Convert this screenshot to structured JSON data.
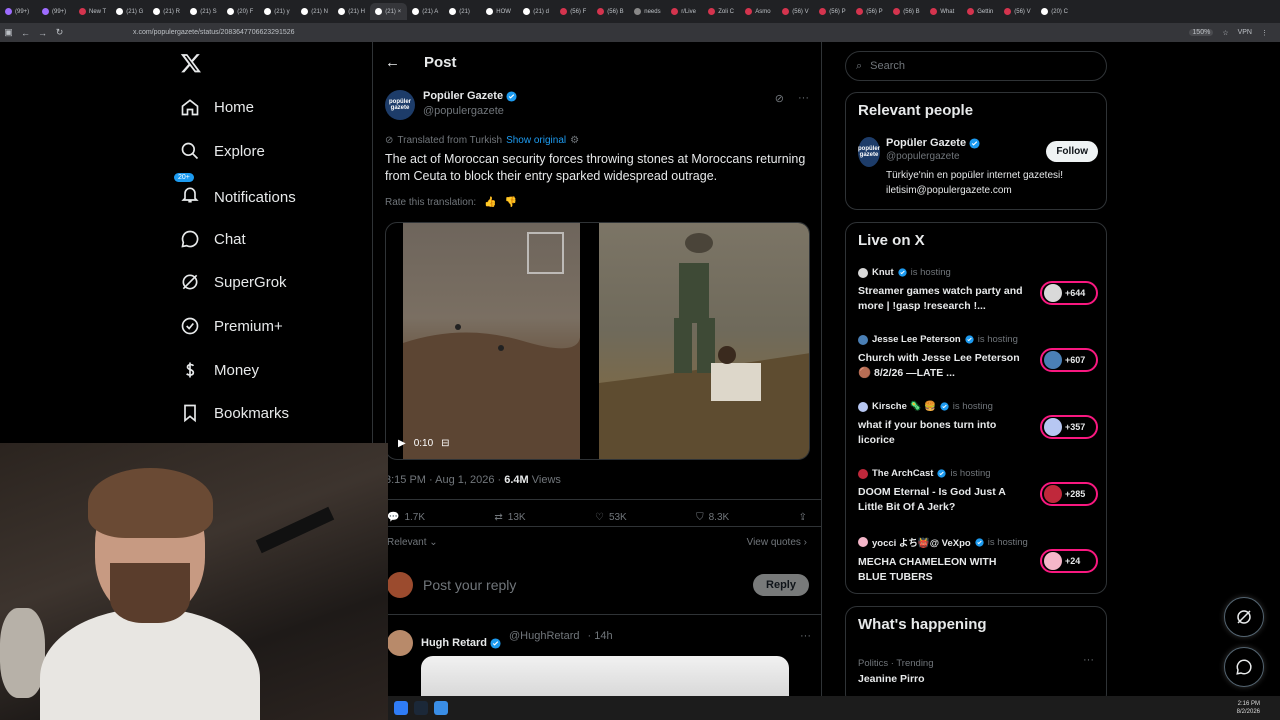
{
  "browser": {
    "tabs": [
      "(99+)",
      "(99+)",
      "New T",
      "(21) G",
      "(21) R",
      "(21) S",
      "(20) F",
      "(21) y",
      "(21) N",
      "(21) H",
      "(21) ×",
      "(21) A",
      "(21)",
      "HOW",
      "(21) d",
      "(56) F",
      "(56) B",
      "needs",
      "r/Live",
      "Zoli C",
      "Asmo",
      "(56) V",
      "(56) P",
      "(56) P",
      "(56) B",
      "What",
      "Gettin",
      "(56) V",
      "(20) C"
    ],
    "url": "x.com/populergazete/status/2083647706623291526",
    "zoom": "150%",
    "vpn": "VPN"
  },
  "nav": {
    "items": [
      {
        "label": "Home",
        "icon": "home-icon"
      },
      {
        "label": "Explore",
        "icon": "search-icon"
      },
      {
        "label": "Notifications",
        "icon": "bell-icon",
        "badge": "20+"
      },
      {
        "label": "Chat",
        "icon": "chat-icon"
      },
      {
        "label": "SuperGrok",
        "icon": "grok-icon"
      },
      {
        "label": "Premium+",
        "icon": "premium-icon"
      },
      {
        "label": "Money",
        "icon": "dollar-icon"
      },
      {
        "label": "Bookmarks",
        "icon": "bookmark-icon"
      }
    ]
  },
  "post": {
    "header": "Post",
    "author_name": "Popüler Gazete",
    "author_handle": "@populergazete",
    "avatar_text": "popüler gazete",
    "translated_from": "Translated from Turkish",
    "show_original": "Show original",
    "text": "The act of Moroccan security forces throwing stones at Moroccans returning from Ceuta to block their entry sparked widespread outrage.",
    "rate_translation": "Rate this translation:",
    "video_time": "0:10",
    "timestamp": "3:15 PM · Aug 1, 2026 · ",
    "views_count": "6.4M",
    "views_label": "Views",
    "replies": "1.7K",
    "reposts": "13K",
    "likes": "53K",
    "bookmarks": "8.3K",
    "sort": "Relevant",
    "view_quotes": "View quotes",
    "reply_placeholder": "Post your reply",
    "reply_button": "Reply"
  },
  "reply": {
    "name": "Hugh Retard",
    "handle": "@HughRetard",
    "time": "· 14h"
  },
  "sidebar": {
    "search_placeholder": "Search",
    "relevant_title": "Relevant people",
    "rp_name": "Popüler Gazete",
    "rp_handle": "@populergazete",
    "rp_bio": "Türkiye'nin en popüler internet gazetesi! iletisim@populergazete.com",
    "follow": "Follow",
    "live_title": "Live on X",
    "is_hosting": "is hosting",
    "live": [
      {
        "host": "Knut",
        "title": "Streamer games watch party and more | !gasp !research !...",
        "count": "+644",
        "color": "#d9d9d9"
      },
      {
        "host": "Jesse Lee Peterson",
        "title": "Church with Jesse Lee Peterson 🟤 8/2/26 —LATE ...",
        "count": "+607",
        "color": "#4a7fb5"
      },
      {
        "host": "Kirsche 🦠 🍔",
        "title": "what if your bones turn into licorice",
        "count": "+357",
        "color": "#b7c7f2"
      },
      {
        "host": "The ArchCast",
        "title": "DOOM Eternal - Is God Just A Little Bit Of A Jerk?",
        "count": "+285",
        "color": "#c0283b"
      },
      {
        "host": "yocci よち👹@ VeXpo",
        "title": "MECHA CHAMELEON WITH BLUE TUBERS",
        "count": "+24",
        "color": "#f4b6c9"
      }
    ],
    "happening_title": "What's happening",
    "happening_cat": "Politics · Trending",
    "happening_item": "Jeanine Pirro"
  },
  "taskbar": {
    "time": "2:16 PM",
    "date": "8/2/2026"
  },
  "colors": {
    "accent": "#1d9bf0",
    "live": "#f91880"
  }
}
